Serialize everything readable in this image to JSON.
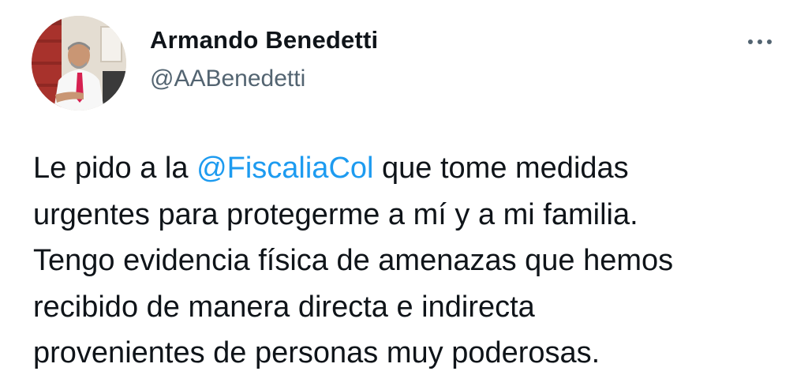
{
  "author": {
    "display_name": "Armando Benedetti",
    "handle": "@AABenedetti",
    "avatar": "profile-photo"
  },
  "more_menu": {
    "icon": "more-horizontal-icon"
  },
  "tweet": {
    "line1_before": "Le pido a la ",
    "mention": "@FiscaliaCol",
    "line1_after": " que tome medidas",
    "line2": "urgentes para protegerme a mí y a mi familia.",
    "line3": "Tengo evidencia física de amenazas que hemos",
    "line4": "recibido de manera directa e indirecta",
    "line5": "provenientes de personas muy poderosas."
  },
  "colors": {
    "text": "#0f1419",
    "secondary": "#536471",
    "link": "#1d9bf0",
    "background": "#ffffff"
  }
}
